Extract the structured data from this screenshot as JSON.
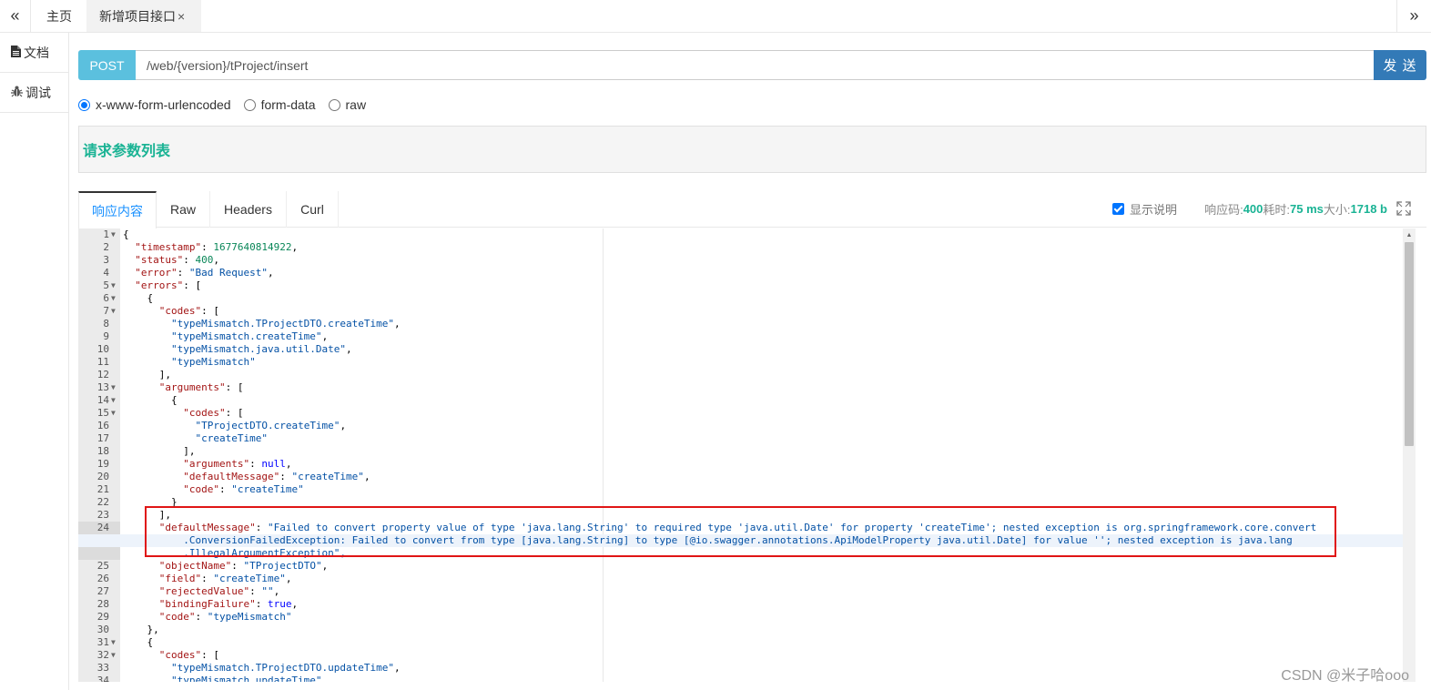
{
  "topbar": {
    "nav_left": "«",
    "nav_right": "»",
    "tabs": [
      {
        "label": "主页"
      },
      {
        "label": "新增项目接口",
        "close": "×"
      }
    ]
  },
  "sidebar": {
    "items": [
      {
        "label": "文档",
        "icon": "file-icon"
      },
      {
        "label": "调试",
        "icon": "bug-icon"
      }
    ]
  },
  "request": {
    "method": "POST",
    "url": "/web/{version}/tProject/insert",
    "send_label": "发 送"
  },
  "content_types": [
    {
      "label": "x-www-form-urlencoded",
      "checked": true
    },
    {
      "label": "form-data",
      "checked": false
    },
    {
      "label": "raw",
      "checked": false
    }
  ],
  "params": {
    "title": "请求参数列表"
  },
  "response": {
    "tabs": [
      "响应内容",
      "Raw",
      "Headers",
      "Curl"
    ],
    "show_desc_label": "显示说明",
    "show_desc_checked": true,
    "code_label": "响应码:",
    "code_value": "400",
    "time_label": "耗时:",
    "time_value": "75 ms",
    "size_label": "大小:",
    "size_value": "1718 b"
  },
  "editor_lines": [
    {
      "n": "1",
      "f": true,
      "t": "{"
    },
    {
      "n": "2",
      "t": "  \"timestamp\": 1677640814922,"
    },
    {
      "n": "3",
      "t": "  \"status\": 400,"
    },
    {
      "n": "4",
      "t": "  \"error\": \"Bad Request\","
    },
    {
      "n": "5",
      "f": true,
      "t": "  \"errors\": ["
    },
    {
      "n": "6",
      "f": true,
      "t": "    {"
    },
    {
      "n": "7",
      "f": true,
      "t": "      \"codes\": ["
    },
    {
      "n": "8",
      "t": "        \"typeMismatch.TProjectDTO.createTime\","
    },
    {
      "n": "9",
      "t": "        \"typeMismatch.createTime\","
    },
    {
      "n": "10",
      "t": "        \"typeMismatch.java.util.Date\","
    },
    {
      "n": "11",
      "t": "        \"typeMismatch\""
    },
    {
      "n": "12",
      "t": "      ],"
    },
    {
      "n": "13",
      "f": true,
      "t": "      \"arguments\": ["
    },
    {
      "n": "14",
      "f": true,
      "t": "        {"
    },
    {
      "n": "15",
      "f": true,
      "t": "          \"codes\": ["
    },
    {
      "n": "16",
      "t": "            \"TProjectDTO.createTime\","
    },
    {
      "n": "17",
      "t": "            \"createTime\""
    },
    {
      "n": "18",
      "t": "          ],"
    },
    {
      "n": "19",
      "t": "          \"arguments\": null,"
    },
    {
      "n": "20",
      "t": "          \"defaultMessage\": \"createTime\","
    },
    {
      "n": "21",
      "t": "          \"code\": \"createTime\""
    },
    {
      "n": "22",
      "t": "        }"
    },
    {
      "n": "23",
      "t": "      ],"
    },
    {
      "n": "24",
      "t": "      \"defaultMessage\": \"Failed to convert property value of type 'java.lang.String' to required type 'java.util.Date' for property 'createTime'; nested exception is org.springframework.core.convert"
    },
    {
      "n": "",
      "t": "          .ConversionFailedException: Failed to convert from type [java.lang.String] to type [@io.swagger.annotations.ApiModelProperty java.util.Date] for value ''; nested exception is java.lang"
    },
    {
      "n": "",
      "t": "          .IllegalArgumentException\","
    },
    {
      "n": "25",
      "t": "      \"objectName\": \"TProjectDTO\","
    },
    {
      "n": "26",
      "t": "      \"field\": \"createTime\","
    },
    {
      "n": "27",
      "t": "      \"rejectedValue\": \"\","
    },
    {
      "n": "28",
      "t": "      \"bindingFailure\": true,"
    },
    {
      "n": "29",
      "t": "      \"code\": \"typeMismatch\""
    },
    {
      "n": "30",
      "t": "    },"
    },
    {
      "n": "31",
      "f": true,
      "t": "    {"
    },
    {
      "n": "32",
      "f": true,
      "t": "      \"codes\": ["
    },
    {
      "n": "33",
      "t": "        \"typeMismatch.TProjectDTO.updateTime\","
    },
    {
      "n": "34",
      "t": "        \"typeMismatch.updateTime\","
    }
  ],
  "watermark": "CSDN @米子哈ooo",
  "colors": {
    "method_bg": "#5bc0de",
    "send_bg": "#337ab7",
    "accent_green": "#1ab394",
    "active_tab": "#1890ff",
    "highlight_border": "#e01515"
  }
}
